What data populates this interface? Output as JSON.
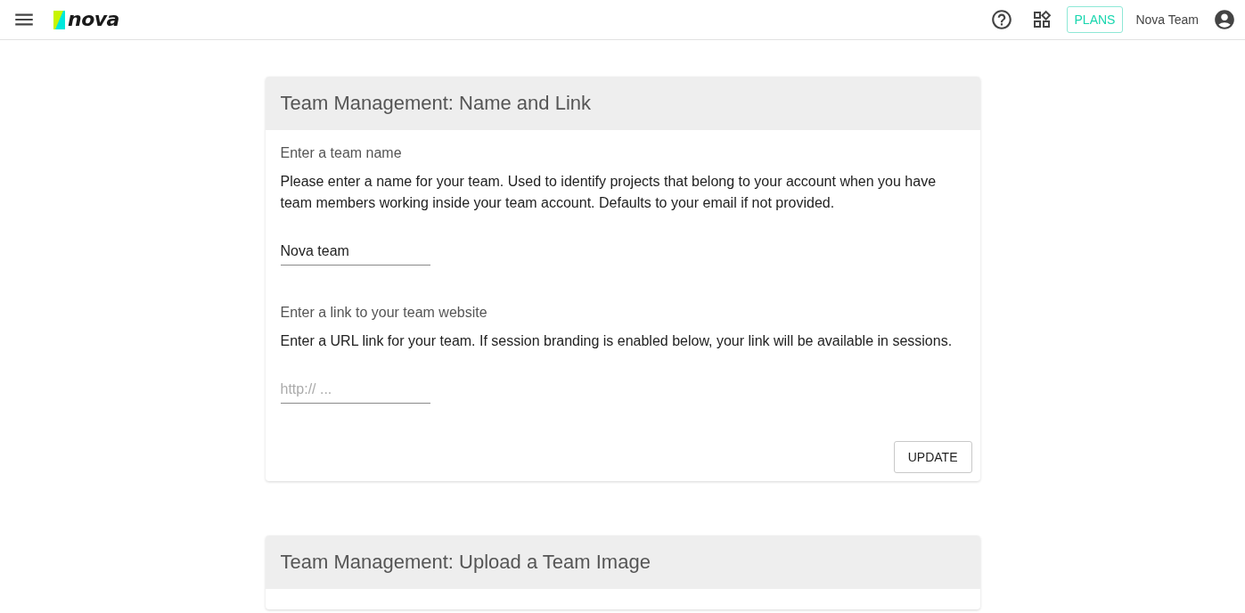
{
  "top_bar": {
    "logo_text": "nova",
    "plans_button": "PLANS",
    "user_name": "Nova Team"
  },
  "cards": [
    {
      "title": "Team Management: Name and Link",
      "fields": [
        {
          "label": "Enter a team name",
          "description": "Please enter a name for your team. Used to identify projects that belong to your account when you have team members working inside your team account. Defaults to your email if not provided.",
          "value": "Nova team"
        },
        {
          "label": "Enter a link to your team website",
          "description": "Enter a URL link for your team. If session branding is enabled below, your link will be available in sessions.",
          "placeholder": "http:// ..."
        }
      ],
      "button": "UPDATE"
    },
    {
      "title": "Team Management: Upload a Team Image"
    }
  ]
}
